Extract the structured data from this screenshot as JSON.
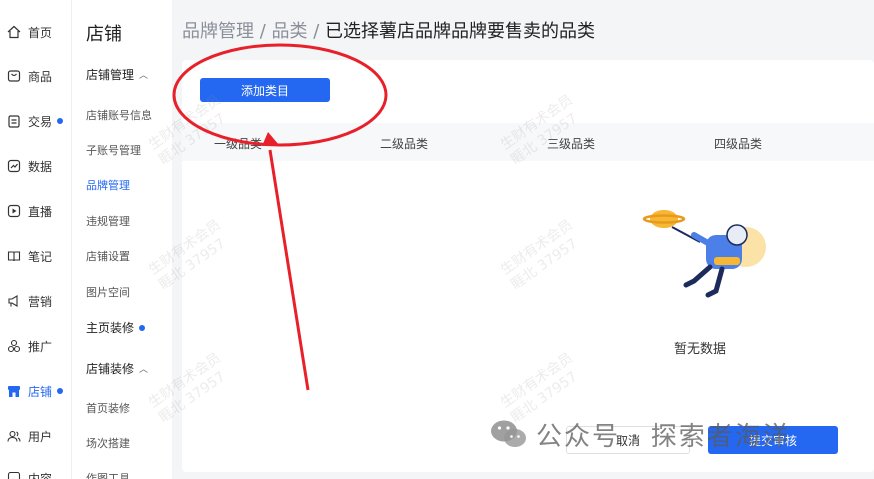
{
  "rail": {
    "items": [
      {
        "label": "首页",
        "icon": "home-icon"
      },
      {
        "label": "商品",
        "icon": "goods-icon"
      },
      {
        "label": "交易",
        "icon": "trade-icon",
        "dot": true
      },
      {
        "label": "数据",
        "icon": "data-icon"
      },
      {
        "label": "直播",
        "icon": "live-icon"
      },
      {
        "label": "笔记",
        "icon": "notes-icon"
      },
      {
        "label": "营销",
        "icon": "marketing-icon"
      },
      {
        "label": "推广",
        "icon": "promote-icon"
      },
      {
        "label": "店铺",
        "icon": "store-icon",
        "dot": true,
        "active": true
      },
      {
        "label": "用户",
        "icon": "user-icon"
      },
      {
        "label": "内容",
        "icon": "content-icon"
      }
    ]
  },
  "subnav": {
    "title": "店铺",
    "group1": "店铺管理",
    "items1": [
      "店铺账号信息",
      "子账号管理",
      "品牌管理",
      "违规管理",
      "店铺设置",
      "图片空间"
    ],
    "group2": "主页装修",
    "group3": "店铺装修",
    "items3": [
      "首页装修",
      "场次搭建",
      "作图工具"
    ]
  },
  "breadcrumb": {
    "part1": "品牌管理",
    "sep": " / ",
    "part2": "品类",
    "current": "已选择薯店品牌品牌要售卖的品类"
  },
  "panel": {
    "add_button": "添加类目",
    "columns": [
      "一级品类",
      "二级品类",
      "三级品类",
      "四级品类"
    ],
    "empty_text": "暂无数据",
    "cancel_button": "取消",
    "submit_button": "提交审核"
  },
  "watermark": {
    "line1": "生财有术会员",
    "line2": "睚北 37957"
  },
  "overlay": {
    "text": "公众号 · 探索者海洋"
  },
  "colors": {
    "primary": "#2468f2",
    "annotation": "#e8202a"
  }
}
